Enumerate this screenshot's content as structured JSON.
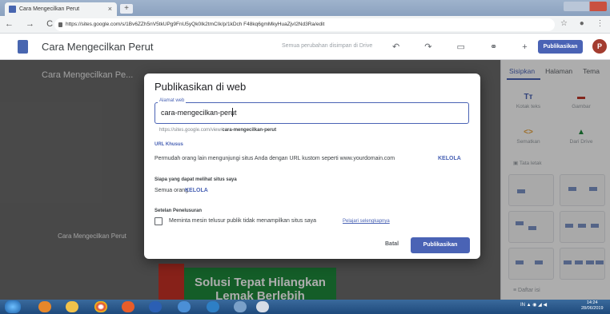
{
  "browser": {
    "tab_title": "Cara Mengecilkan Perut",
    "tab_close": "×",
    "new_tab": "+",
    "nav_glyphs": "← → C",
    "url": "https://sites.google.com/s/1Bv6ZZh5nV5tkUPg9FnU5yQk0Ik2tmCIk/p/1kDch F48kq6gmMkyHuaZjvI2Nd3Ra/edit"
  },
  "app": {
    "doc_title": "Cara Mengecilkan Perut",
    "save_status": "Semua perubahan disimpan di Drive",
    "publish_button": "Publikasikan",
    "avatar_letter": "P"
  },
  "canvas": {
    "hero_title": "Cara Mengecilkan Pe...",
    "page_card": "Cara Mengecilkan Perut",
    "banner_text": "Solusi Tepat Hilangkan Lemak Berlebih"
  },
  "panel": {
    "tabs": [
      "Sisipkan",
      "Halaman",
      "Tema"
    ],
    "items": [
      {
        "icon": "Tт",
        "label": "Kotak teks"
      },
      {
        "icon": "▬",
        "label": "Gambar"
      },
      {
        "icon": "<>",
        "label": "Sematkan"
      },
      {
        "icon": "▲",
        "label": "Dari Drive"
      }
    ],
    "layouts_label": "Tata letak",
    "list_label": "Daftar isi"
  },
  "dialog": {
    "title": "Publikasikan di web",
    "field_label": "Alamat web",
    "field_value": "cara-mengecilkan-perut",
    "url_prefix": "https://sites.google.com/view/",
    "url_slug": "cara-mengecilkan-perut",
    "custom_url_heading": "URL Khusus",
    "custom_url_text": "Permudah orang lain mengunjungi situs Anda dengan URL kustom seperti www.yourdomain.com",
    "manage_link_1": "KELOLA",
    "visitors_heading": "Siapa yang dapat melihat situs saya",
    "visitors_value": "Semua orang",
    "manage_link_2": "KELOLA",
    "search_heading": "Setelan Penelusuran",
    "search_checkbox": "Meminta mesin telusur publik tidak menampilkan situs saya",
    "learn_more": "Pelajari selengkapnya",
    "cancel_button": "Batal",
    "publish_button": "Publikasikan"
  },
  "taskbar": {
    "time": "14:24",
    "date": "28/06/2019",
    "lang": "IN"
  },
  "colors": {
    "accent": "#4a63b5",
    "banner_green": "#1e8a3c"
  }
}
